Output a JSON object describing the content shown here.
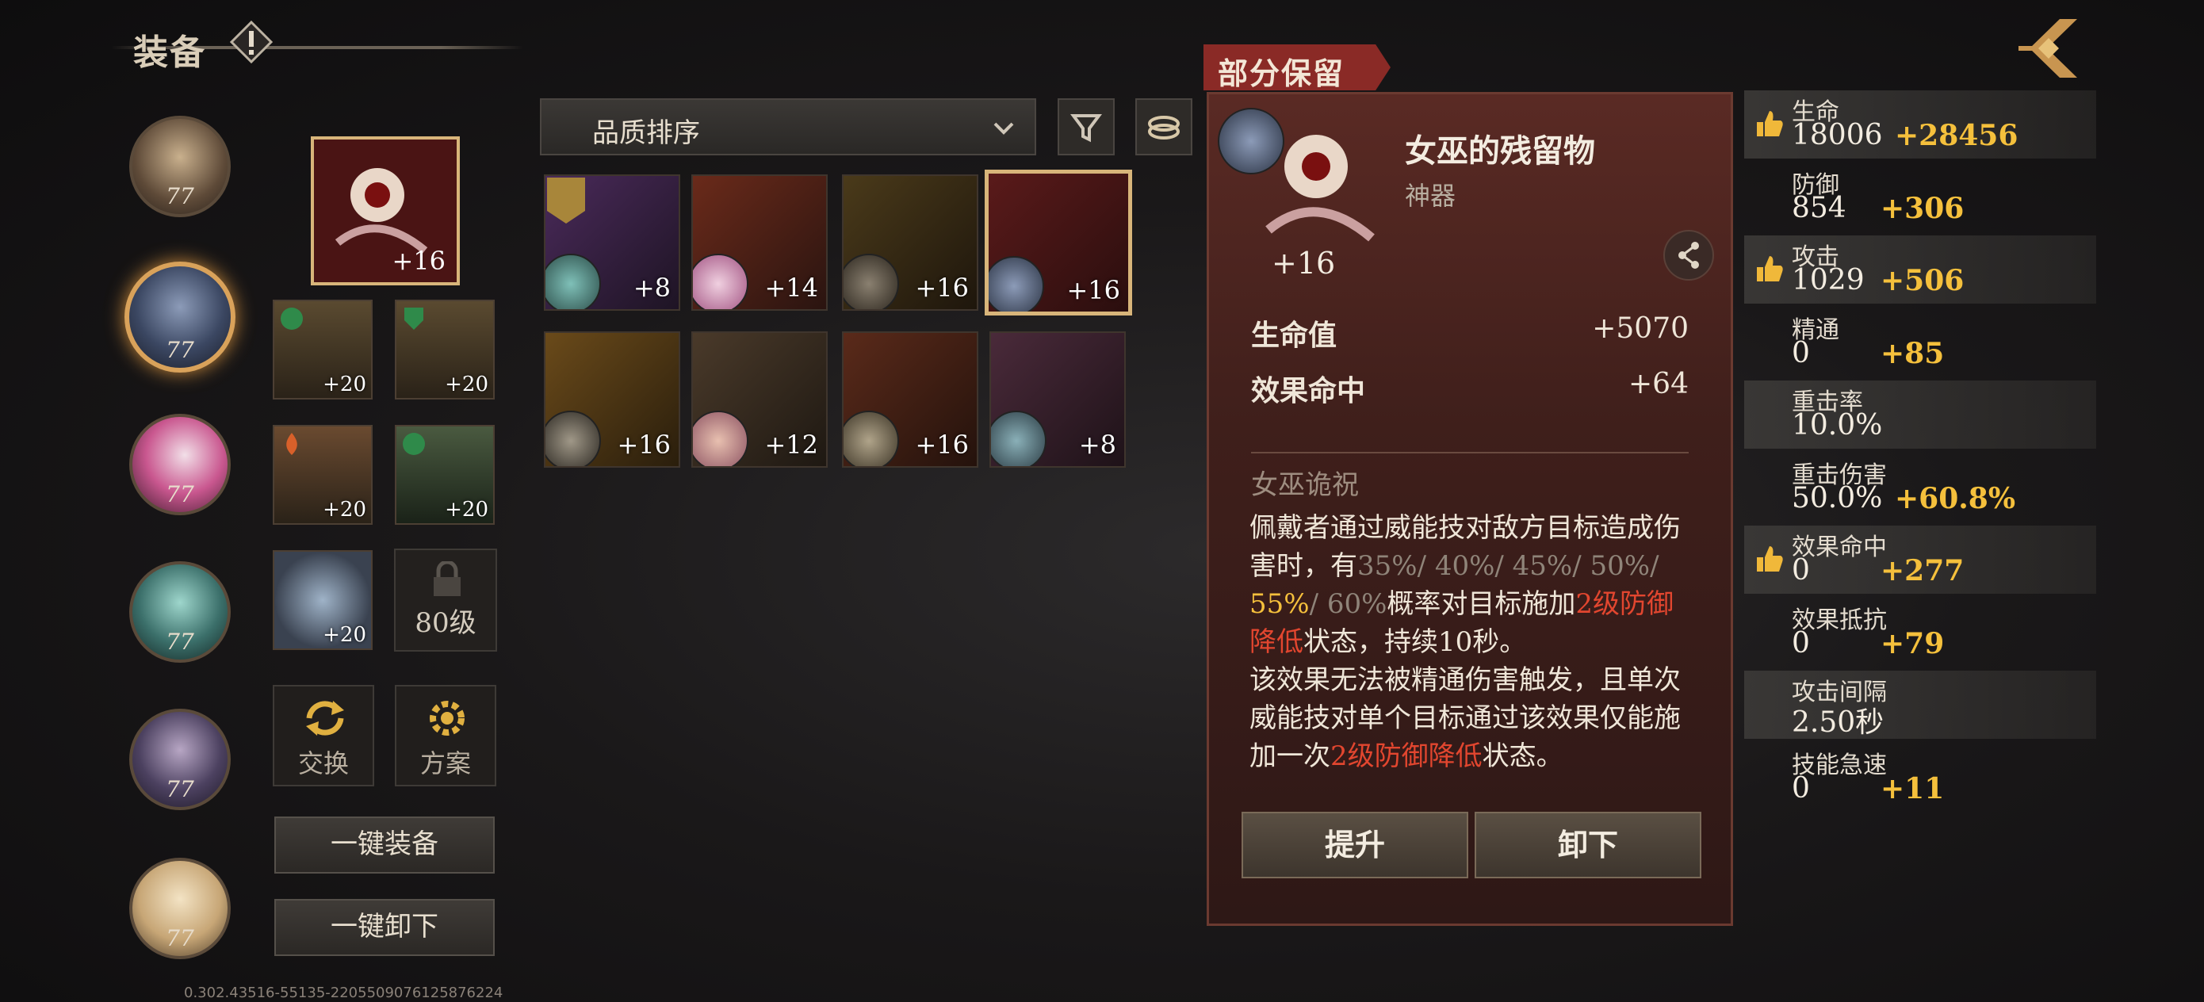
{
  "header": {
    "title": "装备",
    "info_icon": "exclamation-icon",
    "back_icon": "back-arrow-icon"
  },
  "heroes": [
    {
      "level": "77",
      "selected": false
    },
    {
      "level": "77",
      "selected": true
    },
    {
      "level": "77",
      "selected": false
    },
    {
      "level": "77",
      "selected": false
    },
    {
      "level": "77",
      "selected": false
    },
    {
      "level": "77",
      "selected": false
    }
  ],
  "equipped": {
    "main": {
      "plus": "+16"
    },
    "slots": [
      {
        "plus": "+20"
      },
      {
        "plus": "+20"
      },
      {
        "plus": "+20"
      },
      {
        "plus": "+20"
      },
      {
        "plus": "+20"
      }
    ],
    "locked_label": "80级",
    "exchange_label": "交换",
    "plan_label": "方案",
    "equip_all_label": "一键装备",
    "unequip_all_label": "一键卸下"
  },
  "sort": {
    "label": "品质排序",
    "filter_icon": "filter-icon",
    "ring_icon": "ring-icon"
  },
  "items": [
    {
      "plus": "+8"
    },
    {
      "plus": "+14"
    },
    {
      "plus": "+16"
    },
    {
      "plus": "+16"
    },
    {
      "plus": "+16"
    },
    {
      "plus": "+12"
    },
    {
      "plus": "+16"
    },
    {
      "plus": "+8"
    }
  ],
  "detail": {
    "tag": "部分保留",
    "name": "女巫的残留物",
    "type": "神器",
    "plus": "+16",
    "stats": [
      {
        "label": "生命值",
        "value": "+5070"
      },
      {
        "label": "效果命中",
        "value": "+64"
      }
    ],
    "skill_title": "女巫诡祝",
    "desc": {
      "p1": "佩戴者通过威能技对敌方目标造成伤害时，有",
      "r1": "35%/ 40%/ 45%/ 50%/",
      "r2": "55%",
      "r3": "/ 60%",
      "p2": "概率对目标施加",
      "e1": "2级防御降低",
      "p3": "状态，持续10秒。",
      "p4": "该效果无法被精通伤害触发，且单次威能技对单个目标通过该效果仅能施加一次",
      "e2": "2级防御降低",
      "p5": "状态。"
    },
    "upgrade_label": "提升",
    "unequip_label": "卸下"
  },
  "stats": [
    {
      "label": "生命",
      "base": "18006",
      "bonus": "+28456",
      "thumb": true
    },
    {
      "label": "防御",
      "base": "854",
      "bonus": "+306",
      "thumb": false
    },
    {
      "label": "攻击",
      "base": "1029",
      "bonus": "+506",
      "thumb": true
    },
    {
      "label": "精通",
      "base": "0",
      "bonus": "+85",
      "thumb": false
    },
    {
      "label": "重击率",
      "base": "10.0%",
      "bonus": "",
      "thumb": false
    },
    {
      "label": "重击伤害",
      "base": "50.0%",
      "bonus": "+60.8%",
      "thumb": false
    },
    {
      "label": "效果命中",
      "base": "0",
      "bonus": "+277",
      "thumb": true
    },
    {
      "label": "效果抵抗",
      "base": "0",
      "bonus": "+79",
      "thumb": false
    },
    {
      "label": "攻击间隔",
      "base": "2.50秒",
      "bonus": "",
      "thumb": false
    },
    {
      "label": "技能急速",
      "base": "0",
      "bonus": "+11",
      "thumb": false
    }
  ],
  "version": "0.302.43516-55135-2205509076125876224",
  "colors": {
    "accent_gold": "#f5c03c",
    "effect_red": "#e2462f",
    "panel_red": "#5a2a24"
  }
}
